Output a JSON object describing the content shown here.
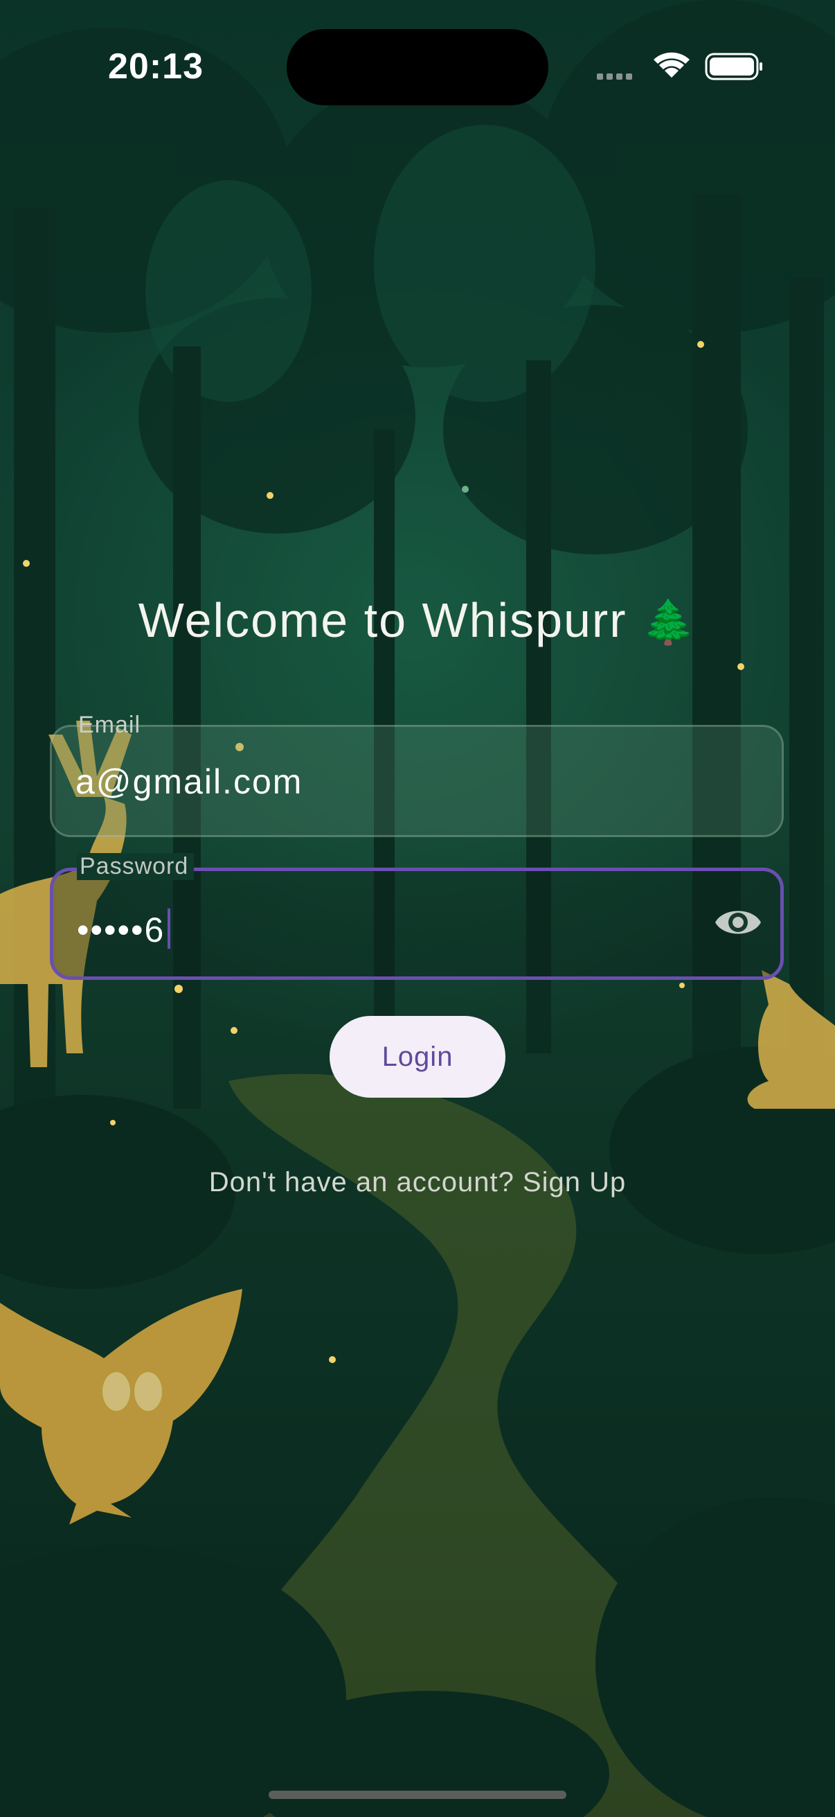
{
  "status_bar": {
    "time": "20:13",
    "icons": [
      "signal-icon",
      "wifi-icon",
      "battery-icon"
    ]
  },
  "welcome": {
    "title": "Welcome to Whispurr",
    "emoji": "🌲"
  },
  "form": {
    "email": {
      "label": "Email",
      "value": "a@gmail.com"
    },
    "password": {
      "label": "Password",
      "value": "•••••6",
      "toggle_icon": "eye-icon"
    },
    "login_label": "Login",
    "signup_text": "Don't have an account? Sign Up"
  },
  "colors": {
    "accent": "#6a4fb0",
    "button_bg": "#f3eef8",
    "button_text": "#5f4a9b",
    "background": "#0f3f30"
  }
}
